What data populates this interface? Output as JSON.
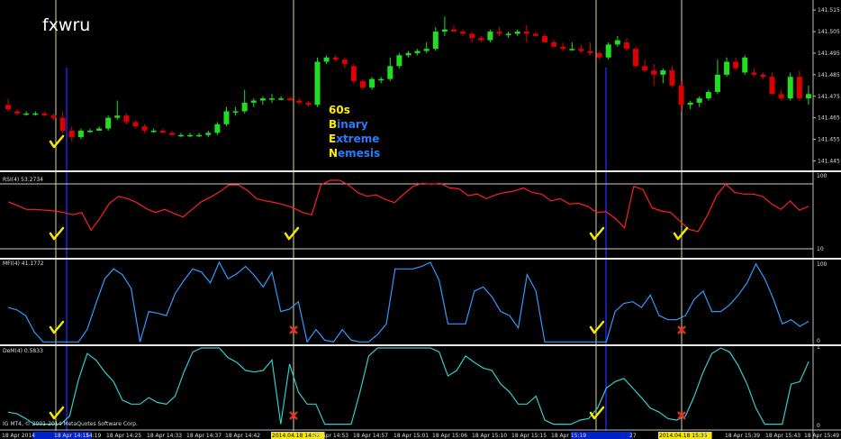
{
  "watermark": "fxwru",
  "overlay": {
    "line1": "60s",
    "lines": [
      {
        "initial": "B",
        "rest": "inary"
      },
      {
        "initial": "E",
        "rest": "xtreme"
      },
      {
        "initial": "N",
        "rest": "emesis"
      }
    ]
  },
  "colors": {
    "background": "#000000",
    "bull": "#22dd22",
    "bear": "#dd0000",
    "rsi": "#ff2020",
    "mfi": "#3399ff",
    "dem": "#33cccc",
    "vline": "#d8d8a0",
    "vline_blue": "#1a1aaa",
    "check": "#f5e800",
    "cross": "#e03020",
    "scale_text": "#dddddd",
    "overlay_initial": "#ffee00",
    "overlay_rest": "#2a7bff"
  },
  "price_axis": {
    "labels": [
      "141.515",
      "141.505",
      "141.495",
      "141.485",
      "141.475",
      "141.465",
      "141.455",
      "141.445"
    ],
    "min": 141.441,
    "max": 141.518
  },
  "panels": {
    "rsi": {
      "label": "RSI(4) 53.2734",
      "scale": [
        "100",
        "10"
      ]
    },
    "mfi": {
      "label": "MFI(4) 41.1772",
      "scale": [
        "100",
        "0"
      ]
    },
    "dem": {
      "label": "DeM(4) 0.5833",
      "scale": [
        "1",
        "0"
      ]
    }
  },
  "copyright": "IG MT4, © 2001-2014 MetaQuotes Software Corp.",
  "time_axis": {
    "labels": [
      "18 Apr 2014",
      "18 Apr 14:15",
      "14:19",
      "18 Apr 14:25",
      "18 Apr 14:33",
      "18 Apr 14:37",
      "18 Apr 14:42",
      "2014.04.18 14:52",
      "18 Apr 14:53",
      "18 Apr 14:57",
      "18 Apr 15:01",
      "18 Apr 15:06",
      "18 Apr 15:10",
      "18 Apr 15:15",
      "18 Apr 15:19",
      "27",
      "2014.04.18 15:35",
      "35",
      "18 Apr 15:39",
      "18 Apr 15:43",
      "18 Apr 15:49"
    ]
  },
  "markers": {
    "checks": [
      {
        "x": 62,
        "panel": "price"
      },
      {
        "x": 323,
        "panel": "rsi"
      },
      {
        "x": 62,
        "panel": "rsi"
      },
      {
        "x": 662,
        "panel": "rsi"
      },
      {
        "x": 755,
        "panel": "rsi"
      },
      {
        "x": 62,
        "panel": "mfi"
      },
      {
        "x": 662,
        "panel": "mfi"
      },
      {
        "x": 62,
        "panel": "dem"
      },
      {
        "x": 662,
        "panel": "dem"
      }
    ],
    "crosses": [
      {
        "x": 326,
        "panel": "mfi"
      },
      {
        "x": 757,
        "panel": "mfi"
      },
      {
        "x": 326,
        "panel": "dem"
      },
      {
        "x": 757,
        "panel": "dem"
      }
    ]
  },
  "chart_data": [
    {
      "type": "candlestick",
      "title": "",
      "ylim": [
        141.441,
        141.518
      ],
      "candles": [
        [
          141.471,
          141.474,
          141.468,
          141.469
        ],
        [
          141.468,
          141.469,
          141.466,
          141.467
        ],
        [
          141.467,
          141.468,
          141.466,
          141.467
        ],
        [
          141.467,
          141.468,
          141.466,
          141.467
        ],
        [
          141.467,
          141.468,
          141.466,
          141.466
        ],
        [
          141.466,
          141.467,
          141.464,
          141.465
        ],
        [
          141.465,
          141.468,
          141.458,
          141.459
        ],
        [
          141.459,
          141.461,
          141.454,
          141.456
        ],
        [
          141.456,
          141.46,
          141.455,
          141.459
        ],
        [
          141.459,
          141.46,
          141.458,
          141.459
        ],
        [
          141.459,
          141.461,
          141.459,
          141.46
        ],
        [
          141.46,
          141.466,
          141.459,
          141.465
        ],
        [
          141.465,
          141.473,
          141.464,
          141.466
        ],
        [
          141.466,
          141.467,
          141.462,
          141.463
        ],
        [
          141.463,
          141.464,
          141.46,
          141.461
        ],
        [
          141.461,
          141.462,
          141.458,
          141.459
        ],
        [
          141.459,
          141.46,
          141.458,
          141.459
        ],
        [
          141.459,
          141.46,
          141.458,
          141.458
        ],
        [
          141.458,
          141.459,
          141.457,
          141.457
        ],
        [
          141.457,
          141.458,
          141.456,
          141.457
        ],
        [
          141.457,
          141.458,
          141.456,
          141.457
        ],
        [
          141.457,
          141.458,
          141.456,
          141.457
        ],
        [
          141.457,
          141.459,
          141.456,
          141.458
        ],
        [
          141.458,
          141.463,
          141.457,
          141.462
        ],
        [
          141.462,
          141.47,
          141.461,
          141.468
        ],
        [
          141.468,
          141.47,
          141.466,
          141.468
        ],
        [
          141.468,
          141.478,
          141.467,
          141.472
        ],
        [
          141.472,
          141.474,
          141.47,
          141.473
        ],
        [
          141.473,
          141.475,
          141.471,
          141.474
        ],
        [
          141.474,
          141.476,
          141.472,
          141.474
        ],
        [
          141.474,
          141.475,
          141.473,
          141.474
        ],
        [
          141.474,
          141.475,
          141.473,
          141.473
        ],
        [
          141.473,
          141.474,
          141.471,
          141.472
        ],
        [
          141.472,
          141.473,
          141.47,
          141.471
        ],
        [
          141.471,
          141.493,
          141.47,
          141.491
        ],
        [
          141.491,
          141.494,
          141.49,
          141.493
        ],
        [
          141.493,
          141.494,
          141.491,
          141.492
        ],
        [
          141.492,
          141.493,
          141.488,
          141.49
        ],
        [
          141.489,
          141.49,
          141.481,
          141.482
        ],
        [
          141.482,
          141.483,
          141.478,
          141.479
        ],
        [
          141.479,
          141.484,
          141.478,
          141.483
        ],
        [
          141.483,
          141.484,
          141.481,
          141.483
        ],
        [
          141.483,
          141.493,
          141.482,
          141.489
        ],
        [
          141.489,
          141.495,
          141.488,
          141.494
        ],
        [
          141.494,
          141.496,
          141.493,
          141.495
        ],
        [
          141.495,
          141.497,
          141.494,
          141.496
        ],
        [
          141.496,
          141.5,
          141.495,
          141.497
        ],
        [
          141.497,
          141.507,
          141.496,
          141.505
        ],
        [
          141.505,
          141.512,
          141.503,
          141.506
        ],
        [
          141.506,
          141.508,
          141.505,
          141.505
        ],
        [
          141.505,
          141.506,
          141.503,
          141.504
        ],
        [
          141.504,
          141.505,
          141.5,
          141.502
        ],
        [
          141.502,
          141.503,
          141.5,
          141.501
        ],
        [
          141.501,
          141.506,
          141.5,
          141.505
        ],
        [
          141.505,
          141.507,
          141.503,
          141.504
        ],
        [
          141.504,
          141.505,
          141.502,
          141.504
        ],
        [
          141.504,
          141.506,
          141.503,
          141.505
        ],
        [
          141.505,
          141.508,
          141.5,
          141.504
        ],
        [
          141.504,
          141.505,
          141.503,
          141.503
        ],
        [
          141.503,
          141.504,
          141.5,
          141.5
        ],
        [
          141.5,
          141.501,
          141.498,
          141.498
        ],
        [
          141.498,
          141.5,
          141.496,
          141.497
        ],
        [
          141.497,
          141.5,
          141.496,
          141.497
        ],
        [
          141.497,
          141.499,
          141.495,
          141.496
        ],
        [
          141.496,
          141.5,
          141.494,
          141.495
        ],
        [
          141.495,
          141.496,
          141.492,
          141.493
        ],
        [
          141.493,
          141.5,
          141.492,
          141.499
        ],
        [
          141.499,
          141.503,
          141.498,
          141.501
        ],
        [
          141.5,
          141.502,
          141.496,
          141.497
        ],
        [
          141.497,
          141.498,
          141.488,
          141.489
        ],
        [
          141.489,
          141.492,
          141.486,
          141.487
        ],
        [
          141.487,
          141.49,
          141.48,
          141.485
        ],
        [
          141.485,
          141.488,
          141.481,
          141.487
        ],
        [
          141.487,
          141.489,
          141.479,
          141.48
        ],
        [
          141.48,
          141.482,
          141.468,
          141.471
        ],
        [
          141.471,
          141.473,
          141.469,
          141.472
        ],
        [
          141.472,
          141.475,
          141.47,
          141.474
        ],
        [
          141.474,
          141.478,
          141.473,
          141.477
        ],
        [
          141.477,
          141.492,
          141.476,
          141.485
        ],
        [
          141.485,
          141.493,
          141.484,
          141.491
        ],
        [
          141.491,
          141.493,
          141.487,
          141.488
        ],
        [
          141.486,
          141.494,
          141.485,
          141.493
        ],
        [
          141.486,
          141.488,
          141.484,
          141.485
        ],
        [
          141.485,
          141.486,
          141.483,
          141.484
        ],
        [
          141.484,
          141.486,
          141.476,
          141.476
        ],
        [
          141.476,
          141.478,
          141.473,
          141.474
        ],
        [
          141.474,
          141.486,
          141.473,
          141.484
        ],
        [
          141.484,
          141.487,
          141.473,
          141.474
        ],
        [
          141.474,
          141.48,
          141.471,
          141.476
        ]
      ]
    },
    {
      "type": "line",
      "series": [
        {
          "name": "RSI(4)",
          "values": [
            72,
            67,
            62,
            62,
            61,
            60,
            58,
            55,
            58,
            35,
            51,
            70,
            79,
            76,
            71,
            63,
            58,
            62,
            57,
            52,
            62,
            72,
            78,
            85,
            94,
            94,
            87,
            76,
            73,
            71,
            68,
            64,
            58,
            55,
            94,
            100,
            100,
            94,
            84,
            79,
            81,
            75,
            71,
            82,
            92,
            96,
            95,
            96,
            90,
            89,
            80,
            82,
            76,
            81,
            84,
            86,
            90,
            84,
            82,
            73,
            76,
            69,
            70,
            66,
            58,
            59,
            50,
            38,
            92,
            88,
            64,
            60,
            58,
            47,
            36,
            33,
            54,
            80,
            95,
            84,
            82,
            82,
            79,
            69,
            62,
            73,
            61,
            66
          ]
        }
      ],
      "ylim": [
        0,
        100
      ]
    },
    {
      "type": "line",
      "series": [
        {
          "name": "MFI(4)",
          "values": [
            45,
            42,
            35,
            15,
            3,
            3,
            3,
            3,
            3,
            18,
            50,
            80,
            92,
            85,
            68,
            3,
            40,
            38,
            35,
            62,
            78,
            92,
            88,
            75,
            100,
            80,
            86,
            95,
            84,
            70,
            88,
            40,
            43,
            52,
            3,
            18,
            5,
            3,
            18,
            5,
            3,
            3,
            12,
            25,
            92,
            92,
            92,
            95,
            100,
            78,
            25,
            25,
            25,
            65,
            70,
            58,
            40,
            35,
            20,
            85,
            65,
            3,
            3,
            3,
            3,
            3,
            3,
            3,
            3,
            40,
            50,
            52,
            45,
            60,
            35,
            30,
            30,
            35,
            55,
            65,
            40,
            40,
            48,
            60,
            75,
            98,
            80,
            55,
            25,
            30,
            22,
            28
          ]
        }
      ],
      "ylim": [
        0,
        100
      ]
    },
    {
      "type": "line",
      "series": [
        {
          "name": "DeM(4)",
          "values": [
            0.2,
            0.18,
            0.12,
            0.05,
            0.05,
            0.05,
            0.05,
            0.15,
            0.6,
            0.93,
            0.85,
            0.7,
            0.58,
            0.35,
            0.3,
            0.3,
            0.38,
            0.32,
            0.3,
            0.4,
            0.7,
            0.95,
            1,
            1,
            1,
            0.88,
            0.82,
            0.72,
            0.7,
            0.72,
            0.85,
            0.05,
            0.8,
            0.45,
            0.3,
            0.3,
            0.05,
            0.05,
            0.05,
            0.05,
            0.45,
            0.9,
            1,
            1,
            1,
            1,
            1,
            1,
            1,
            0.95,
            0.65,
            0.72,
            0.9,
            0.82,
            0.75,
            0.72,
            0.55,
            0.45,
            0.3,
            0.3,
            0.4,
            0.1,
            0.05,
            0.05,
            0.05,
            0.1,
            0.12,
            0.25,
            0.5,
            0.58,
            0.62,
            0.5,
            0.38,
            0.25,
            0.2,
            0.12,
            0.1,
            0.15,
            0.4,
            0.7,
            0.93,
            1,
            0.95,
            0.78,
            0.55,
            0.25,
            0.05,
            0.05,
            0.05,
            0.55,
            0.58,
            0.83
          ]
        }
      ],
      "ylim": [
        0,
        1
      ]
    }
  ]
}
